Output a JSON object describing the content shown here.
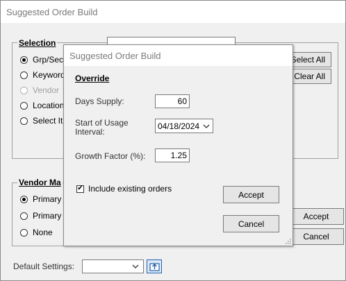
{
  "main_window": {
    "title": "Suggested Order Build",
    "selection": {
      "legend": "Selection",
      "radios": [
        {
          "label": "Grp/Sect",
          "checked": true,
          "disabled": false
        },
        {
          "label": "Keyword",
          "checked": false,
          "disabled": false
        },
        {
          "label": "Vendor",
          "checked": false,
          "disabled": true
        },
        {
          "label": "Location",
          "checked": false,
          "disabled": false
        },
        {
          "label": "Select Ite",
          "checked": false,
          "disabled": false
        }
      ],
      "select_all_label": "Select All",
      "clear_all_label": "Clear All"
    },
    "vendor": {
      "legend": "Vendor Ma",
      "radios": [
        {
          "label": "Primary V",
          "checked": true
        },
        {
          "label": "Primary o",
          "checked": false
        },
        {
          "label": "None",
          "checked": false
        }
      ]
    },
    "accept_label": "Accept",
    "cancel_label": "Cancel",
    "default_settings_label": "Default Settings:",
    "default_settings_value": ""
  },
  "override_dialog": {
    "title": "Suggested Order Build",
    "heading": "Override",
    "days_supply_label": "Days Supply:",
    "days_supply_value": "60",
    "start_usage_label_line1": "Start of Usage",
    "start_usage_label_line2": "Interval:",
    "start_usage_value": "04/18/2024",
    "growth_factor_label": "Growth Factor (%):",
    "growth_factor_value": "1.25",
    "include_existing_label": "Include existing orders",
    "include_existing_checked": true,
    "accept_label": "Accept",
    "cancel_label": "Cancel"
  }
}
